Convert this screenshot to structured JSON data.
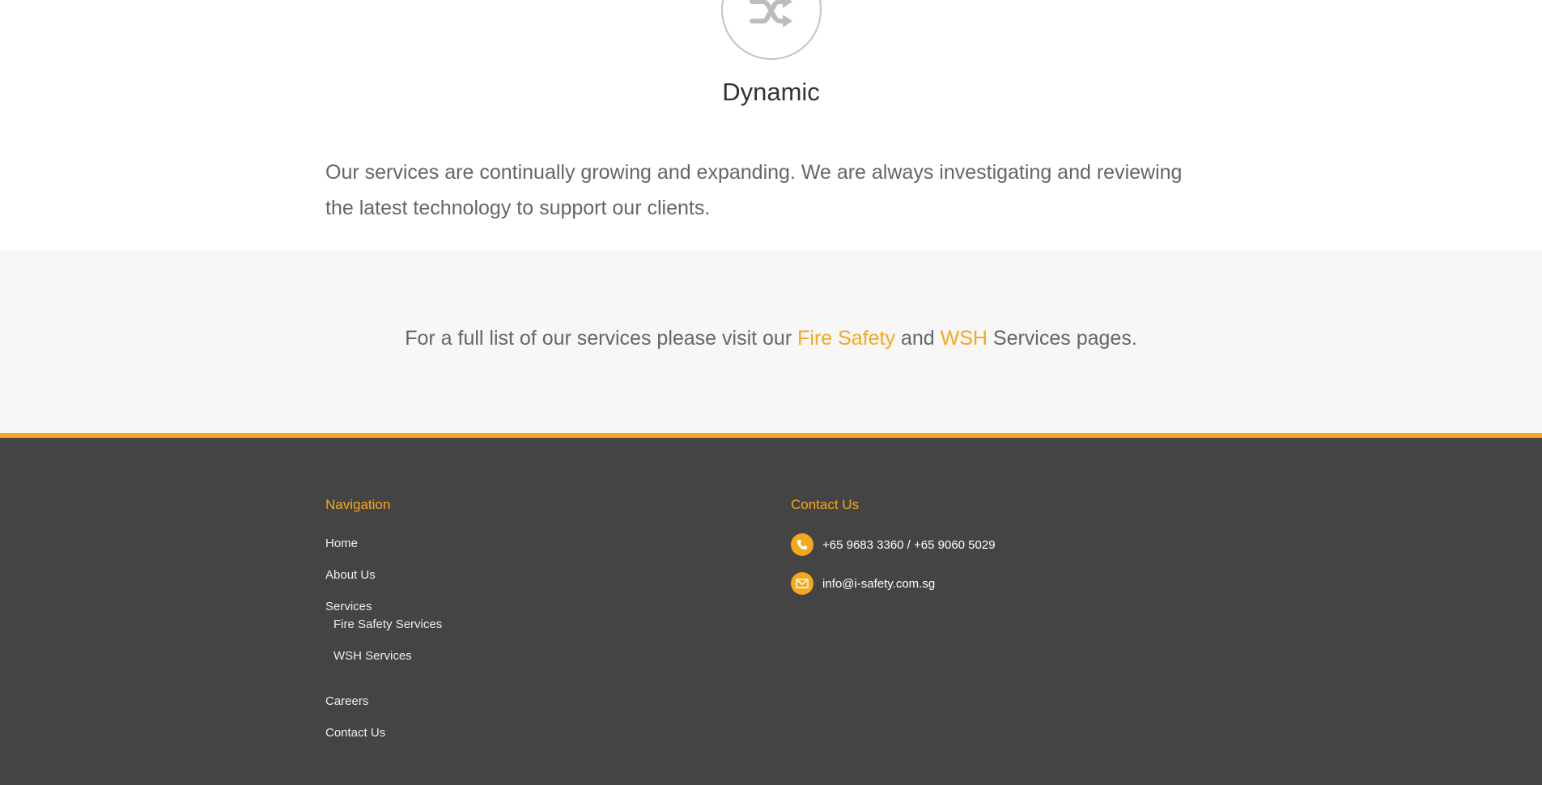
{
  "feature": {
    "icon": "shuffle-icon",
    "title": "Dynamic",
    "description": "Our services are continually growing and expanding. We are always investigating and reviewing the latest technology to support our clients."
  },
  "cta": {
    "prefix": "For a full list of our services please visit our",
    "link1": "Fire Safety",
    "middle": "and",
    "link2": "WSH",
    "suffix": "Services pages."
  },
  "footer": {
    "navigation": {
      "heading": "Navigation",
      "items": [
        {
          "label": "Home"
        },
        {
          "label": "About Us"
        },
        {
          "label": "Services"
        },
        {
          "label": "Fire Safety Services"
        },
        {
          "label": "WSH Services"
        },
        {
          "label": "Careers"
        },
        {
          "label": "Contact Us"
        }
      ]
    },
    "contact": {
      "heading": "Contact Us",
      "phone": "+65 9683 3360 / +65 9060 5029",
      "phone_icon": "phone-icon",
      "email": "info@i-safety.com.sg",
      "email_icon": "envelope-icon"
    }
  },
  "colors": {
    "accent": "#f5a81c",
    "footer_bg": "#444444",
    "cta_bg": "#f7f7f7"
  }
}
